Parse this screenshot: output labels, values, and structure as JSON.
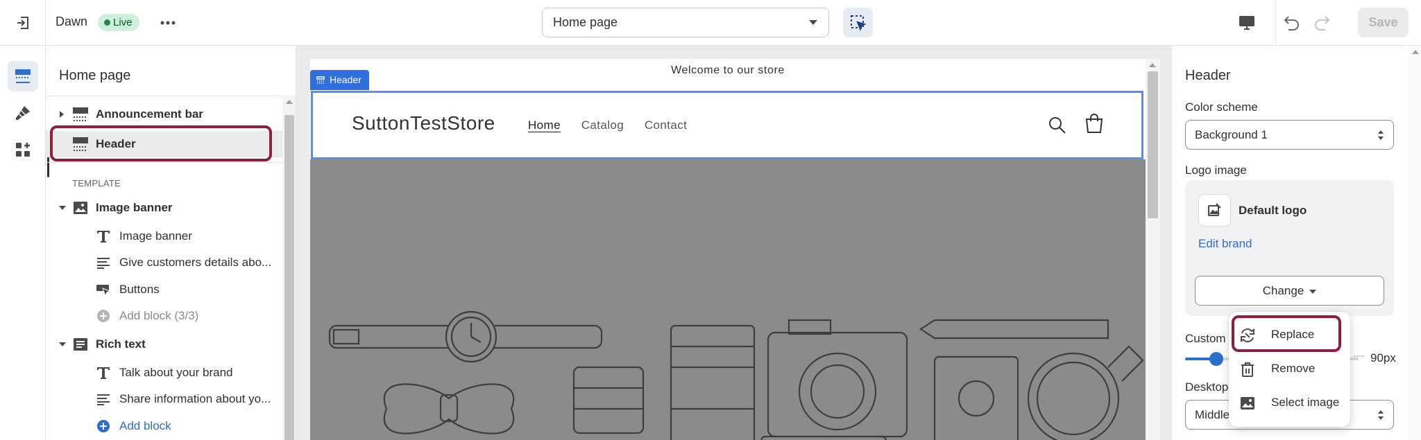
{
  "topbar": {
    "theme_name": "Dawn",
    "live_badge": "Live",
    "page_selector": "Home page",
    "save_label": "Save"
  },
  "sidebar": {
    "title": "Home page",
    "template_label": "TEMPLATE",
    "rows": {
      "announcement_bar": "Announcement bar",
      "header": "Header",
      "image_banner_section": "Image banner",
      "image_banner_block": "Image banner",
      "give_customers": "Give customers details abo...",
      "buttons": "Buttons",
      "add_block_limited": "Add block (3/3)",
      "rich_text": "Rich text",
      "talk_about_brand": "Talk about your brand",
      "share_information": "Share information about yo...",
      "add_block": "Add block"
    }
  },
  "preview": {
    "announcement": "Welcome to our store",
    "header_tag": "Header",
    "store_name": "SuttonTestStore",
    "nav": [
      "Home",
      "Catalog",
      "Contact"
    ]
  },
  "settings": {
    "title": "Header",
    "color_scheme_label": "Color scheme",
    "color_scheme_value": "Background 1",
    "logo_image_label": "Logo image",
    "logo_name": "Default logo",
    "edit_brand": "Edit brand",
    "change_label": "Change",
    "custom_label": "Custom",
    "logo_width_value": "90px",
    "logo_width_fraction": 0.18,
    "desktop_label": "Desktop",
    "desktop_value": "Middle"
  },
  "popover": {
    "items": [
      "Replace",
      "Remove",
      "Select image"
    ]
  },
  "colors": {
    "accent": "#2c6ecb",
    "annotation": "#8e1f3c",
    "preview_outline": "#5a8ce8",
    "live_badge_bg": "#cdf0da",
    "hero_bg": "#8b8b8b"
  }
}
